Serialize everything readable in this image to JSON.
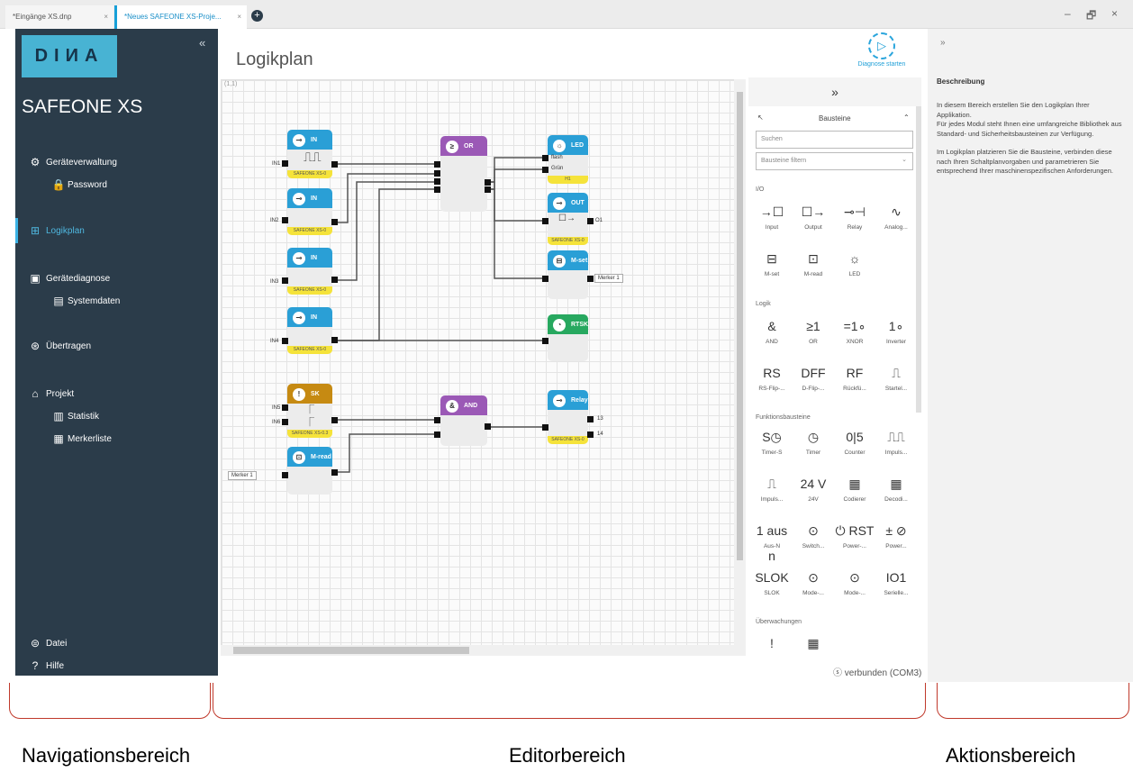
{
  "tabs": [
    {
      "label": "*Eingänge XS.dnp",
      "close": "×"
    },
    {
      "label": "*Neues SAFEONE XS-Proje...",
      "close": "×"
    }
  ],
  "add_tab": "+",
  "window": {
    "minimize": "–",
    "restore": "🗗",
    "close": "×"
  },
  "nav": {
    "logo": "DIИA",
    "collapse": "«",
    "product": "SAFEONE XS",
    "items": [
      {
        "label": "Geräteverwaltung",
        "icon": "device-management-icon"
      },
      {
        "label": "Password",
        "icon": "lock-icon"
      },
      {
        "label": "Logikplan",
        "icon": "logic-plan-icon"
      },
      {
        "label": "Gerätediagnose",
        "icon": "device-diagnosis-icon"
      },
      {
        "label": "Systemdaten",
        "icon": "system-data-icon"
      },
      {
        "label": "Übertragen",
        "icon": "transfer-icon"
      },
      {
        "label": "Projekt",
        "icon": "project-icon"
      },
      {
        "label": "Statistik",
        "icon": "statistics-icon"
      },
      {
        "label": "Merkerliste",
        "icon": "flag-list-icon"
      },
      {
        "label": "Datei",
        "icon": "file-menu-icon"
      },
      {
        "label": "Hilfe",
        "icon": "help-icon"
      }
    ]
  },
  "editor": {
    "title": "Logikplan",
    "diagnose_label": "Diagnose starten",
    "coord": "(1,1)",
    "status": "verbunden (COM3)",
    "blocks": {
      "in1": {
        "title": "IN",
        "footer": "SAFEONE XS-0",
        "pin": "IN1"
      },
      "in2": {
        "title": "IN",
        "footer": "SAFEONE XS-0",
        "pin": "IN2"
      },
      "in3": {
        "title": "IN",
        "footer": "SAFEONE XS-0",
        "pin": "IN3"
      },
      "in4": {
        "title": "IN",
        "footer": "SAFEONE XS-0",
        "pin": "IN4"
      },
      "or": {
        "title": "OR"
      },
      "led": {
        "title": "LED",
        "p1": "flash",
        "p2": "Grün",
        "footer": "H1"
      },
      "out": {
        "title": "OUT",
        "footer": "SAFEONE XS-0",
        "pin": "O1"
      },
      "mset": {
        "title": "M-set",
        "pin": "Merker 1"
      },
      "rtsk": {
        "title": "RTSK"
      },
      "sk": {
        "title": "SK",
        "pin1": "IN5",
        "pin2": "IN6",
        "footer": "SAFEONE XS-0.3"
      },
      "and": {
        "title": "AND"
      },
      "relay": {
        "title": "Relay",
        "pin1": "13",
        "pin2": "14",
        "footer": "SAFEONE XS-0"
      },
      "mread": {
        "title": "M-read",
        "pin": "Merker 1"
      }
    }
  },
  "library": {
    "expand": "»",
    "title": "Bausteine",
    "search_placeholder": "Suchen",
    "filter_placeholder": "Bausteine filtern",
    "categories": [
      "I/O",
      "Logik",
      "Funktionsbausteine",
      "Überwachungen"
    ],
    "io": [
      {
        "g": "→☐",
        "l": "Input"
      },
      {
        "g": "☐→",
        "l": "Output"
      },
      {
        "g": "⊸⊣",
        "l": "Relay"
      },
      {
        "g": "∿",
        "l": "Analog..."
      },
      {
        "g": "⊟",
        "l": "M-set"
      },
      {
        "g": "⊡",
        "l": "M-read"
      },
      {
        "g": "☼",
        "l": "LED"
      }
    ],
    "logic": [
      {
        "g": "&",
        "l": "AND"
      },
      {
        "g": "≥1",
        "l": "OR"
      },
      {
        "g": "=1∘",
        "l": "XNOR"
      },
      {
        "g": "1∘",
        "l": "Inverter"
      },
      {
        "g": "RS",
        "l": "RS-Flip-..."
      },
      {
        "g": "DFF",
        "l": "D-Flip-..."
      },
      {
        "g": "RF",
        "l": "Rückfü..."
      },
      {
        "g": "⎍",
        "l": "Startel..."
      }
    ],
    "func": [
      {
        "g": "S◷",
        "l": "Timer-S"
      },
      {
        "g": "◷",
        "l": "Timer"
      },
      {
        "g": "0|5",
        "l": "Counter"
      },
      {
        "g": "⎍⎍",
        "l": "Impuls..."
      },
      {
        "g": "⎍",
        "l": "Impuls..."
      },
      {
        "g": "24 V",
        "l": "24V"
      },
      {
        "g": "▦",
        "l": "Codierer"
      },
      {
        "g": "▦",
        "l": "Decodi..."
      },
      {
        "g": "1 aus n",
        "l": "Aus-N"
      },
      {
        "g": "⊙",
        "l": "Switch..."
      },
      {
        "g": "⏻ RST",
        "l": "Power-..."
      },
      {
        "g": "± ⊘",
        "l": "Power..."
      },
      {
        "g": "SLOK",
        "l": "SLOK"
      },
      {
        "g": "⊙",
        "l": "Mode-..."
      },
      {
        "g": "⊙",
        "l": "Mode-..."
      },
      {
        "g": "IO1",
        "l": "Serielle..."
      }
    ],
    "monitor": [
      {
        "g": "!",
        "l": ""
      },
      {
        "g": "▦",
        "l": ""
      }
    ]
  },
  "actions": {
    "expand": "»",
    "title": "Beschreibung",
    "text1": "In diesem Bereich erstellen Sie den Logikplan Ihrer Applikation.",
    "text2": "Für jedes Modul steht Ihnen eine umfangreiche Bibliothek aus Standard- und Sicherheitsbausteinen zur Verfügung.",
    "text3": "Im Logikplan platzieren Sie die Bausteine, verbinden diese nach Ihren Schaltplanvorgaben und parametrieren Sie entsprechend Ihrer maschinenspezifischen Anforderungen."
  },
  "annotations": {
    "nav": "Navigationsbereich",
    "editor": "Editorbereich",
    "actions": "Aktionsbereich"
  }
}
